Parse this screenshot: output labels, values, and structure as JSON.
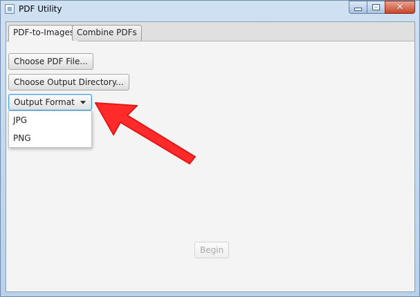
{
  "window": {
    "title": "PDF Utility",
    "icon": "app-window-icon"
  },
  "tabs": [
    {
      "label": "PDF-to-Images",
      "active": true
    },
    {
      "label": "Combine PDFs",
      "active": false
    }
  ],
  "buttons": {
    "choose_pdf": "Choose PDF File...",
    "choose_output": "Choose Output Directory...",
    "begin": "Begin"
  },
  "combo": {
    "value": "Output Format",
    "options": [
      "JPG",
      "PNG"
    ]
  },
  "annotation": {
    "arrow_color": "#ff2b2b"
  }
}
